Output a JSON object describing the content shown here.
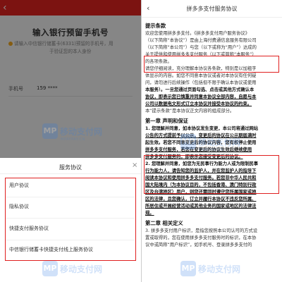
{
  "left": {
    "title": "输入银行预留手机号",
    "notice_line1": "请输入中信银行储蓄卡(6331)预留的手机号，用",
    "notice_line2": "于验证您的本人身份",
    "phone_label": "手机号",
    "phone_value": "159 **** ",
    "sheet": {
      "title": "服务协议",
      "close": "×",
      "items": [
        "用户协议",
        "隐私协议",
        "快捷支付服务协议",
        "中信银行储蓄卡快捷支付线上服务协议"
      ]
    }
  },
  "right": {
    "back": "‹",
    "title": "拼多多支付服务协议",
    "h_preface": "提示条款",
    "p1a": "欢迎您使用拼多多支付。《拼多多支付用户服务协议》",
    "p1b": "（以下简称“本协议”）是由上海付费通信息服务有限公司",
    "p1c": "（以下简称“本公司”）与您（以下或称为“用户”）达成的",
    "p1d": "关于提供和使用拼多多支付服务（以下或简称“本服务”）",
    "p1e": "的各项条款。",
    "p2a": "请您仔细阅读，充分理解本协议各条款，特别是以加粗字",
    "p2b": "体显示的内容。如您不同意本协议或者对本协议有任何疑",
    "p2c": "问，请勿进行后续操作（包括但不限于确认本协议或使用",
    "p2d": "本服务）。一旦您通过页面勾选、点击或其他方式确认本",
    "p2e": "协议，即表示您已慎重并同意本协议全部内容，自愿与本",
    "p2f": "公司以数据电文形式订立本协议并接受本协议的约束。",
    "p2g": "本“提示条款”是本协议正文内容的组成部分。",
    "h1": "第一章 声明和保证",
    "p3a": "1. 您理解并同意，如本协议发生变更，本公司将通过网站",
    "p3b": "公告的方式提前予以公示，变更后的协议在公示期届满时",
    "p3c": "起生效。若您不同意变更后的协议内容，您有权停止使用",
    "p3d": "拼多多支付服务，若您在变更后的协议生效后继续使用",
    "p3e": "拼多多支付服务的，即表示您接受变更后的协议。",
    "p4a": "2. 您理解并同意，如您为无民事行为能力人或为限制民事",
    "p4b": "行为能力人，请告知您的监护人，并在您监护人的指导下",
    "p4c": "阅读本协议和使用拼多多支付服务。若您非中华人民共和",
    "p4d": "国大陆境内（为本协议目的，不包括香港、澳门特别行政",
    "p4e": "区及台湾地区）用户，则您还需同时遵守您所属国家或地",
    "p4f": "区的法律，且您确认，订立并履行本协议不违反您所属、",
    "p4g": "所居住或开展经营活动或其他业务的国家或地区的法律法",
    "p4h": "规。",
    "h2": "第二章 相关定义",
    "p5a": "3. 拼多多支付用户标识，是指您按照本公司认可的方式设",
    "p5b": "置或取得的，您在使用拼多多支付服务时的标识，在本协",
    "p5c": "议中或简称“用户标识”，如手机号、登录拼多多支付的"
  },
  "watermark": {
    "brand": "移动支付网",
    "sub": "MPAYPAY.CN",
    "logo": "MP"
  },
  "colors": {
    "header_red": "#e2241f",
    "highlight_red": "#e02020",
    "watermark_blue": "#2c7be5"
  }
}
